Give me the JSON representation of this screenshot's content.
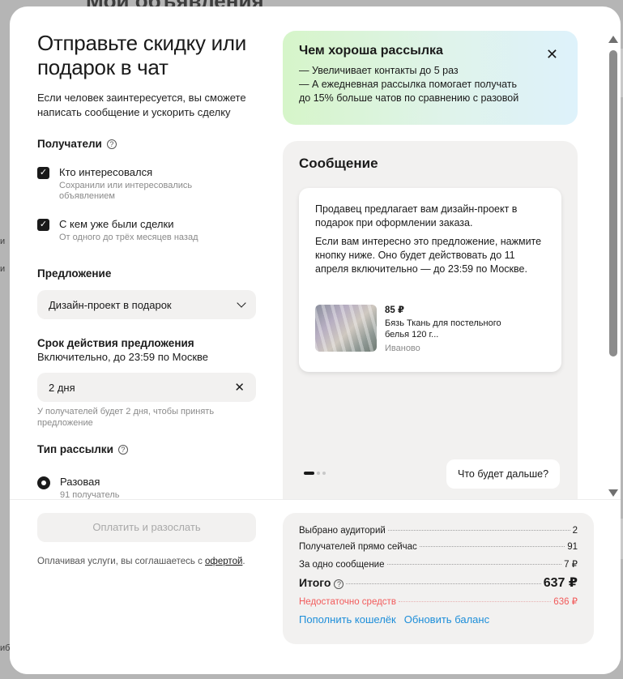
{
  "backdrop": {
    "page_title": "Мои объявления",
    "edge_texts": [
      "и",
      "и",
      "ибр"
    ]
  },
  "modal": {
    "title": "Отправьте скидку или подарок в чат",
    "subtitle": "Если человек заинтересуется, вы сможете написать сообщение и ускорить сделку",
    "recipients": {
      "heading": "Получатели",
      "options": [
        {
          "label": "Кто интересовался",
          "sub": "Сохранили или интересовались объявлением",
          "checked": true
        },
        {
          "label": "С кем уже были сделки",
          "sub": "От одного до трёх месяцев назад",
          "checked": true
        }
      ]
    },
    "offer": {
      "heading": "Предложение",
      "selected": "Дизайн-проект в подарок"
    },
    "validity": {
      "heading": "Срок действия предложения",
      "subheading": "Включительно, до 23:59 по Москве",
      "value": "2 дня",
      "hint": "У получателей будет 2 дня, чтобы принять предложение"
    },
    "mailing_type": {
      "heading": "Тип рассылки",
      "selected_label": "Разовая",
      "selected_sub": "91 получатель"
    },
    "tip": {
      "title": "Чем хороша рассылка",
      "lines": [
        "—  Увеличивает контакты до 5 раз",
        "—  А ежедневная рассылка помогает получать",
        "до 15% больше чатов по сравнению с разовой"
      ]
    },
    "preview": {
      "title": "Сообщение",
      "paragraph1": "Продавец предлагает вам дизайн-проект в подарок при оформлении заказа.",
      "paragraph2": "Если вам интересно это предложение, нажмите кнопку ниже. Оно будет действовать до 11 апреля включительно — до 23:59 по Москве.",
      "product": {
        "price": "85 ₽",
        "name": "Бязь Ткань для постельного белья 120 г...",
        "city": "Иваново"
      },
      "next_button": "Что будет дальше?",
      "slides_total": 3,
      "slide_active": 1
    },
    "footer": {
      "pay_button": "Оплатить и разослать",
      "agree_text": "Оплачивая услуги, вы соглашаетесь с ",
      "agree_link": "офертой",
      "agree_end": ".",
      "summary": {
        "audiences_label": "Выбрано аудиторий",
        "audiences_value": "2",
        "recipients_label": "Получателей прямо сейчас",
        "recipients_value": "91",
        "per_message_label": "За одно сообщение",
        "per_message_value": "7 ₽",
        "total_label": "Итого",
        "total_value": "637 ₽",
        "insufficient_label": "Недостаточно средств",
        "insufficient_value": "636 ₽",
        "topup_link": "Пополнить кошелёк",
        "refresh_link": "Обновить баланс"
      }
    }
  },
  "colors": {
    "accent_link": "#1d8ed9",
    "warning": "#f25b5b",
    "panel_bg": "#f2f1f0"
  },
  "icons": {
    "help": "question-circle-icon",
    "close": "close-icon",
    "dropdown": "chevron-down-icon",
    "check": "checkmark-icon"
  }
}
